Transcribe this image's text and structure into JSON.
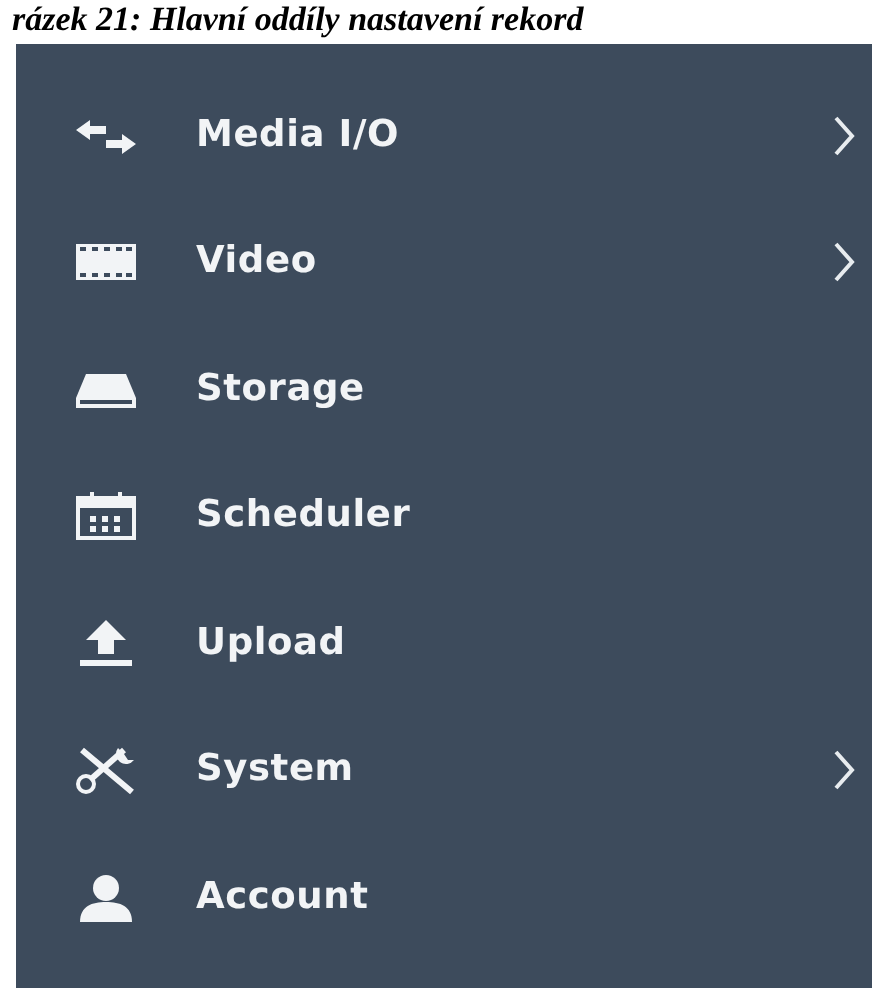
{
  "caption": "rázek 21: Hlavní oddíly nastavení rekord",
  "menu": [
    {
      "label": "Media I/O",
      "submenu": true
    },
    {
      "label": "Video",
      "submenu": true
    },
    {
      "label": "Storage",
      "submenu": false
    },
    {
      "label": "Scheduler",
      "submenu": false
    },
    {
      "label": "Upload",
      "submenu": false
    },
    {
      "label": "System",
      "submenu": true
    },
    {
      "label": "Account",
      "submenu": false
    }
  ]
}
